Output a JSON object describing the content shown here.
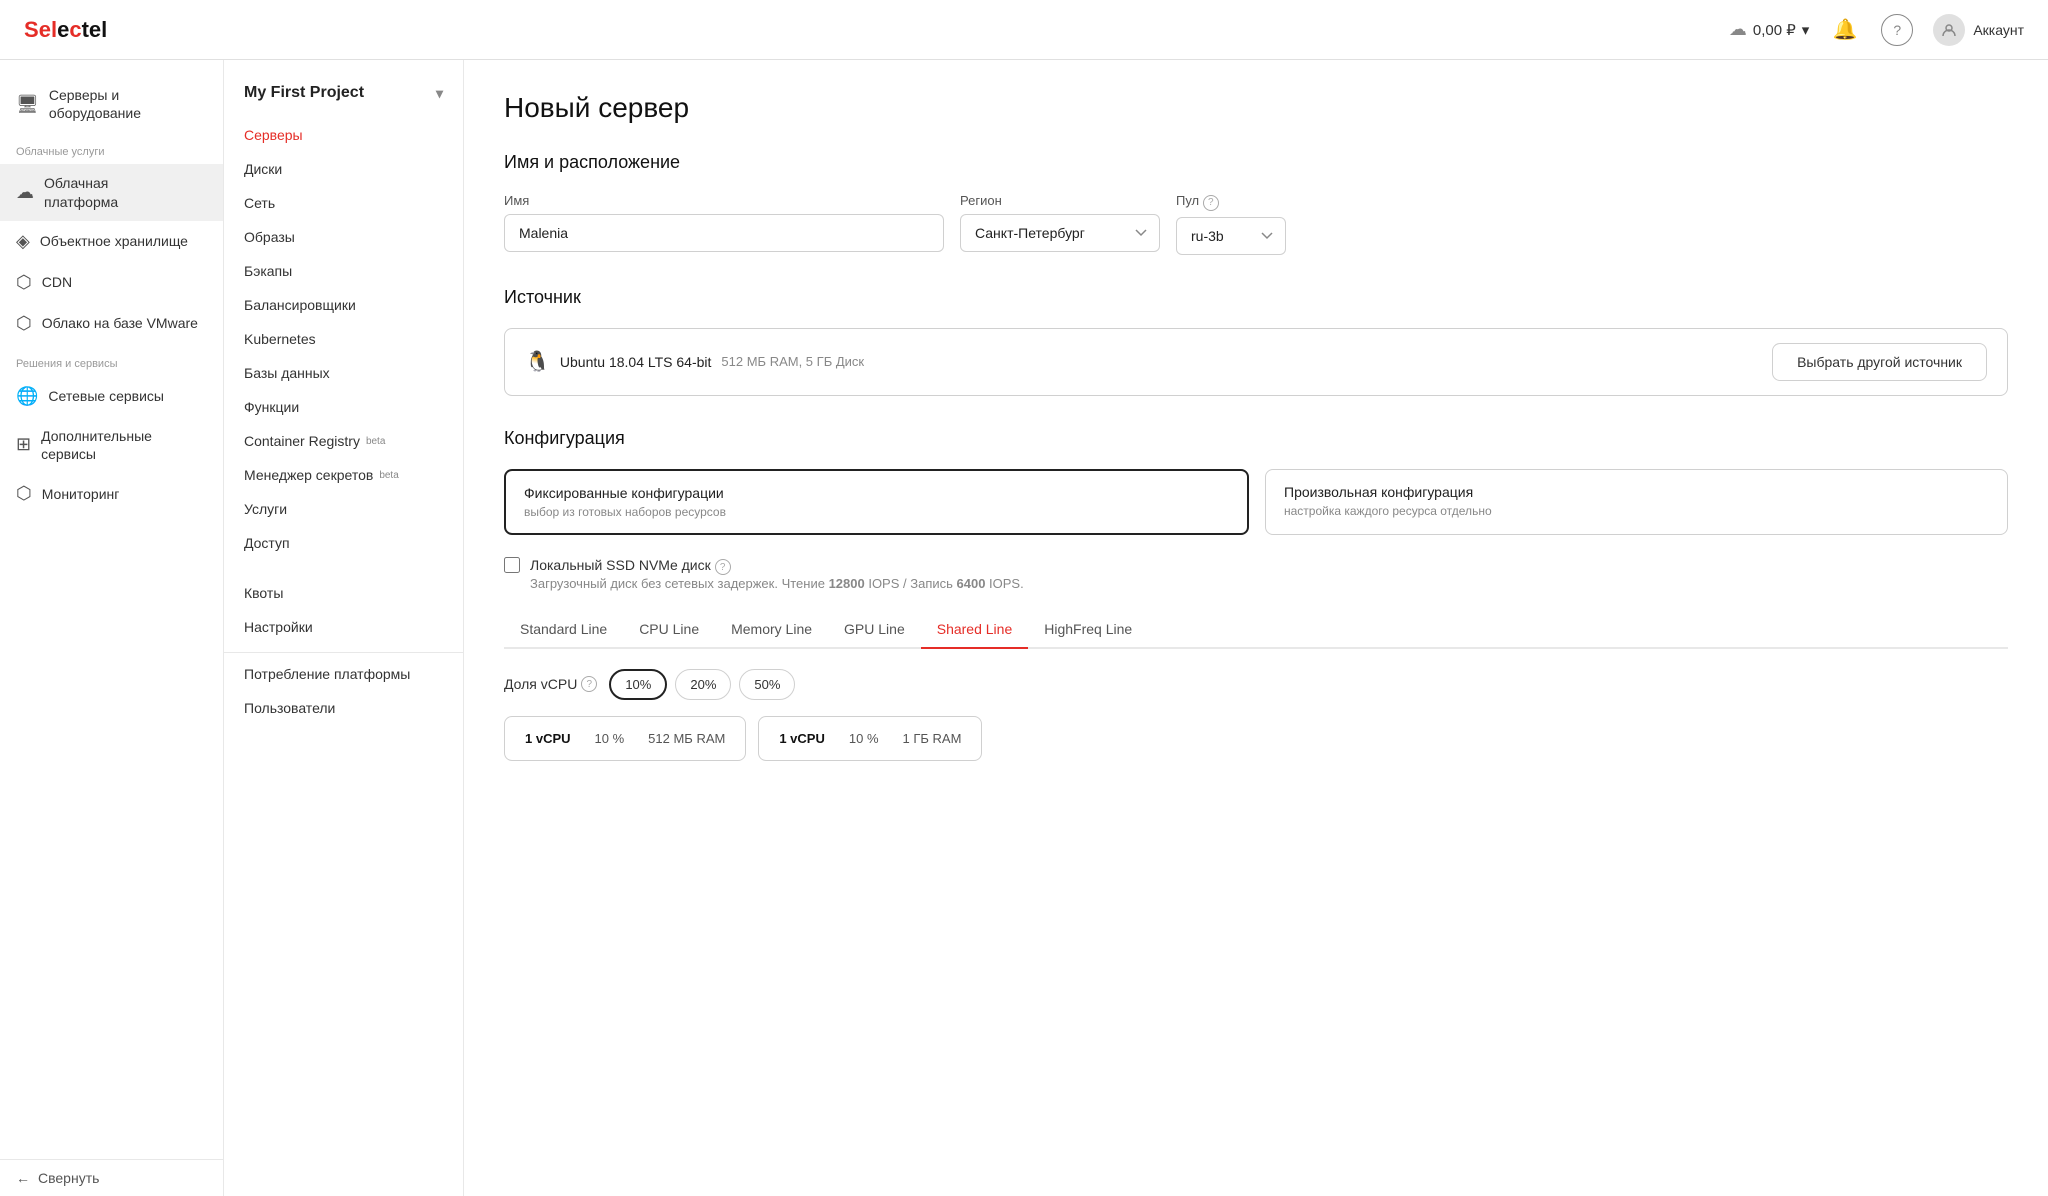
{
  "header": {
    "logo": "Selectel",
    "balance": "0,00 ₽",
    "account_label": "Аккаунт"
  },
  "sidebar_left": {
    "sections": [
      {
        "items": [
          {
            "id": "servers",
            "icon": "🖥",
            "label": "Серверы и оборудование"
          }
        ]
      },
      {
        "label": "Облачные услуги",
        "items": [
          {
            "id": "cloud",
            "icon": "☁",
            "label": "Облачная платформа",
            "active": true
          },
          {
            "id": "object",
            "icon": "◈",
            "label": "Объектное хранилище"
          },
          {
            "id": "cdn",
            "icon": "⬡",
            "label": "CDN"
          },
          {
            "id": "vmware",
            "icon": "⬡",
            "label": "Облако на базе VMware"
          }
        ]
      },
      {
        "label": "Решения и сервисы",
        "items": [
          {
            "id": "network",
            "icon": "🌐",
            "label": "Сетевые сервисы"
          },
          {
            "id": "additional",
            "icon": "⊞",
            "label": "Дополнительные сервисы"
          },
          {
            "id": "monitoring",
            "icon": "⬡",
            "label": "Мониторинг"
          }
        ]
      }
    ],
    "collapse_label": "Свернуть"
  },
  "sidebar_project": {
    "project_name": "My First Project",
    "nav_items": [
      {
        "id": "servers",
        "label": "Серверы",
        "active": true
      },
      {
        "id": "disks",
        "label": "Диски"
      },
      {
        "id": "network",
        "label": "Сеть"
      },
      {
        "id": "images",
        "label": "Образы"
      },
      {
        "id": "backups",
        "label": "Бэкапы"
      },
      {
        "id": "balancers",
        "label": "Балансировщики"
      },
      {
        "id": "kubernetes",
        "label": "Kubernetes"
      },
      {
        "id": "databases",
        "label": "Базы данных"
      },
      {
        "id": "functions",
        "label": "Функции"
      },
      {
        "id": "container",
        "label": "Container Registry",
        "badge": "beta"
      },
      {
        "id": "secrets",
        "label": "Менеджер секретов",
        "badge": "beta"
      },
      {
        "id": "services",
        "label": "Услуги"
      },
      {
        "id": "access",
        "label": "Доступ"
      }
    ],
    "bottom_items": [
      {
        "id": "quotas",
        "label": "Квоты"
      },
      {
        "id": "settings",
        "label": "Настройки"
      }
    ],
    "footer_items": [
      {
        "id": "consumption",
        "label": "Потребление платформы"
      },
      {
        "id": "users",
        "label": "Пользователи"
      }
    ]
  },
  "main": {
    "page_title": "Новый сервер",
    "sections": {
      "name_location": {
        "title": "Имя и расположение",
        "name_label": "Имя",
        "name_value": "Malenia",
        "region_label": "Регион",
        "region_value": "Санкт-Петербург",
        "pool_label": "Пул",
        "pool_value": "ru-3b"
      },
      "source": {
        "title": "Источник",
        "os_name": "Ubuntu 18.04 LTS 64-bit",
        "os_meta": "512 МБ RAM, 5 ГБ Диск",
        "select_btn": "Выбрать другой источник"
      },
      "config": {
        "title": "Конфигурация",
        "options": [
          {
            "id": "fixed",
            "title": "Фиксированные конфигурации",
            "desc": "выбор из готовых наборов ресурсов",
            "selected": true
          },
          {
            "id": "custom",
            "title": "Произвольная конфигурация",
            "desc": "настройка каждого ресурса отдельно",
            "selected": false
          }
        ],
        "ssd_label": "Локальный SSD NVMe диск",
        "ssd_desc_start": "Загрузочный диск без сетевых задержек. Чтение ",
        "ssd_read": "12800",
        "ssd_iops1": " IOPS / Запись ",
        "ssd_write": "6400",
        "ssd_iops2": " IOPS.",
        "tabs": [
          {
            "id": "standard",
            "label": "Standard Line"
          },
          {
            "id": "cpu",
            "label": "CPU Line"
          },
          {
            "id": "memory",
            "label": "Memory Line"
          },
          {
            "id": "gpu",
            "label": "GPU Line"
          },
          {
            "id": "shared",
            "label": "Shared Line",
            "active": true
          },
          {
            "id": "highfreq",
            "label": "HighFreq Line"
          }
        ],
        "vcpu_label": "Доля vCPU",
        "vcpu_options": [
          {
            "label": "10%",
            "value": "10",
            "active": true
          },
          {
            "label": "20%",
            "value": "20"
          },
          {
            "label": "50%",
            "value": "50"
          }
        ],
        "cards": [
          {
            "vcpu": "1 vCPU",
            "share": "10 %",
            "ram": "512 МБ RAM"
          },
          {
            "vcpu": "1 vCPU",
            "share": "10 %",
            "ram": "1 ГБ RAM"
          }
        ]
      }
    }
  }
}
